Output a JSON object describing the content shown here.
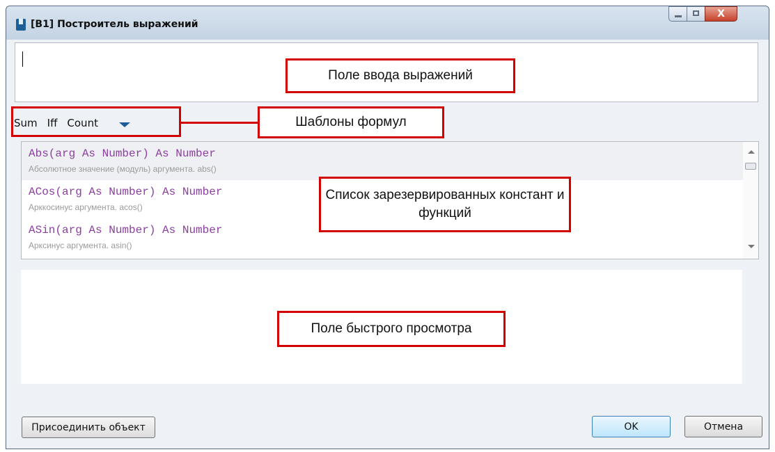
{
  "window": {
    "title": "[B1] Построитель выражений",
    "controls": {
      "minimize": "—",
      "maximize": "▢",
      "close": "X"
    }
  },
  "expression_input": {
    "value": ""
  },
  "templates": [
    "Sum",
    "Iff",
    "Count"
  ],
  "functions": [
    {
      "signature": "Abs(arg As Number) As Number",
      "description": "Абсолютное значение (модуль) аргумента. abs()"
    },
    {
      "signature": "ACos(arg As Number) As Number",
      "description": "Арккосинус аргумента. acos()"
    },
    {
      "signature": "ASin(arg As Number) As Number",
      "description": "Арксинус аргумента. asin()"
    }
  ],
  "buttons": {
    "attach": "Присоединить объект",
    "ok": "OK",
    "cancel": "Отмена"
  },
  "annotations": {
    "expression_field": "Поле ввода выражений",
    "templates": "Шаблоны формул",
    "list": "Список зарезервированных констант и функций",
    "preview": "Поле быстрого просмотра"
  },
  "colors": {
    "annotation": "#d40000",
    "signature": "#8b3f9f",
    "accent": "#1c5c9a"
  }
}
